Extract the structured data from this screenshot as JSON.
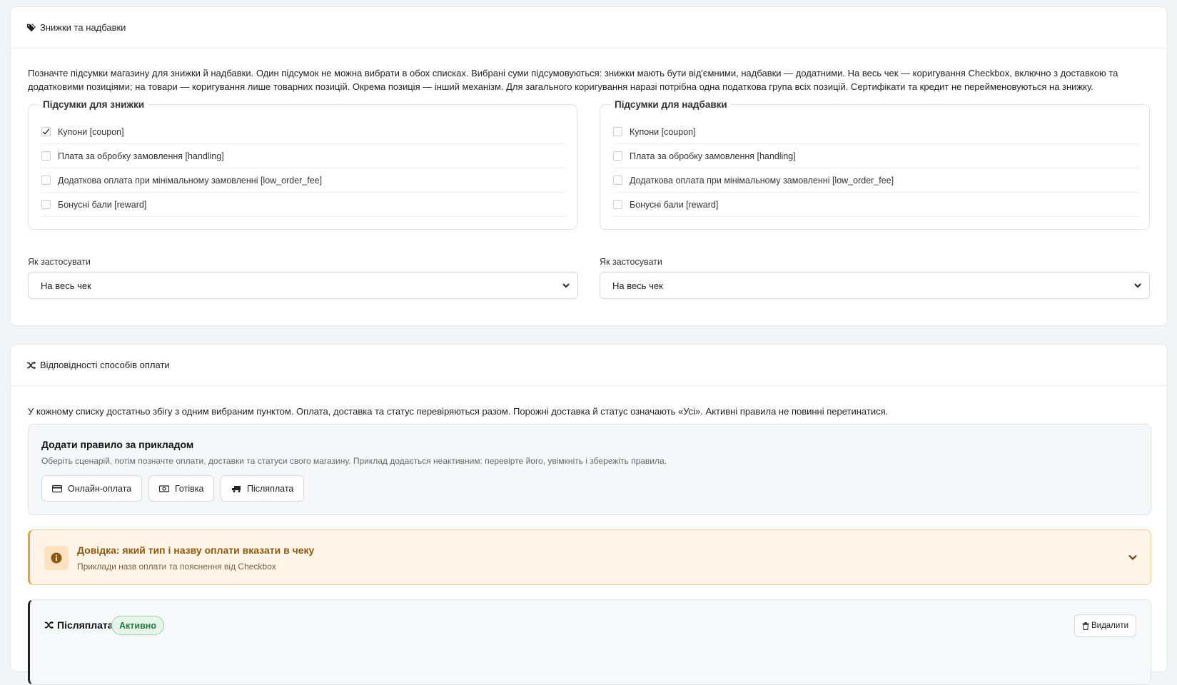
{
  "discounts": {
    "title": "Знижки та надбавки",
    "intro": "Позначте підсумки магазину для знижки й надбавки. Один підсумок не можна вибрати в обох списках. Вибрані суми підсумовуються: знижки мають бути від'ємними, надбавки — додатними. На весь чек — коригування Checkbox, включно з доставкою та додатковими позиціями; на товари — коригування лише товарних позицій. Окрема позиція — інший механізм. Для загального коригування наразі потрібна одна податкова група всіх позицій. Сертифікати та кредит не перейменовуються на знижку.",
    "discount_group": {
      "legend": "Підсумки для знижки",
      "items": [
        {
          "label": "Купони [coupon]",
          "checked": true
        },
        {
          "label": "Плата за обробку замовлення [handling]",
          "checked": false
        },
        {
          "label": "Додаткова оплата при мінімальному замовленні [low_order_fee]",
          "checked": false
        },
        {
          "label": "Бонусні бали [reward]",
          "checked": false
        }
      ]
    },
    "surcharge_group": {
      "legend": "Підсумки для надбавки",
      "items": [
        {
          "label": "Купони [coupon]",
          "checked": false
        },
        {
          "label": "Плата за обробку замовлення [handling]",
          "checked": false
        },
        {
          "label": "Додаткова оплата при мінімальному замовленні [low_order_fee]",
          "checked": false
        },
        {
          "label": "Бонусні бали [reward]",
          "checked": false
        }
      ]
    },
    "apply_label_left": "Як застосувати",
    "apply_value_left": "На весь чек",
    "apply_label_right": "Як застосувати",
    "apply_value_right": "На весь чек"
  },
  "payments": {
    "title": "Відповідності способів оплати",
    "intro": "У кожному списку достатньо збігу з одним вибраним пунктом. Оплата, доставка та статус перевіряються разом. Порожні доставка й статус означають «Усі». Активні правила не повинні перетинатися.",
    "example": {
      "title": "Додати правило за прикладом",
      "subtitle": "Оберіть сценарій, потім позначте оплати, доставки та статуси свого магазину. Приклад додається неактивним: перевірте його, увімкніть і збережіть правила.",
      "buttons": [
        "Онлайн-оплата",
        "Готівка",
        "Післяплата"
      ]
    },
    "help": {
      "title": "Довідка: який тип і назву оплати вказати в чеку",
      "subtitle": "Приклади назв оплати та пояснення від Checkbox"
    },
    "rule": {
      "title": "Післяплата",
      "status": "Активно",
      "delete_label": "Видалити"
    }
  },
  "colors": {
    "accent_warning": "#e3a03c",
    "status_active": "#1e7a3c"
  }
}
